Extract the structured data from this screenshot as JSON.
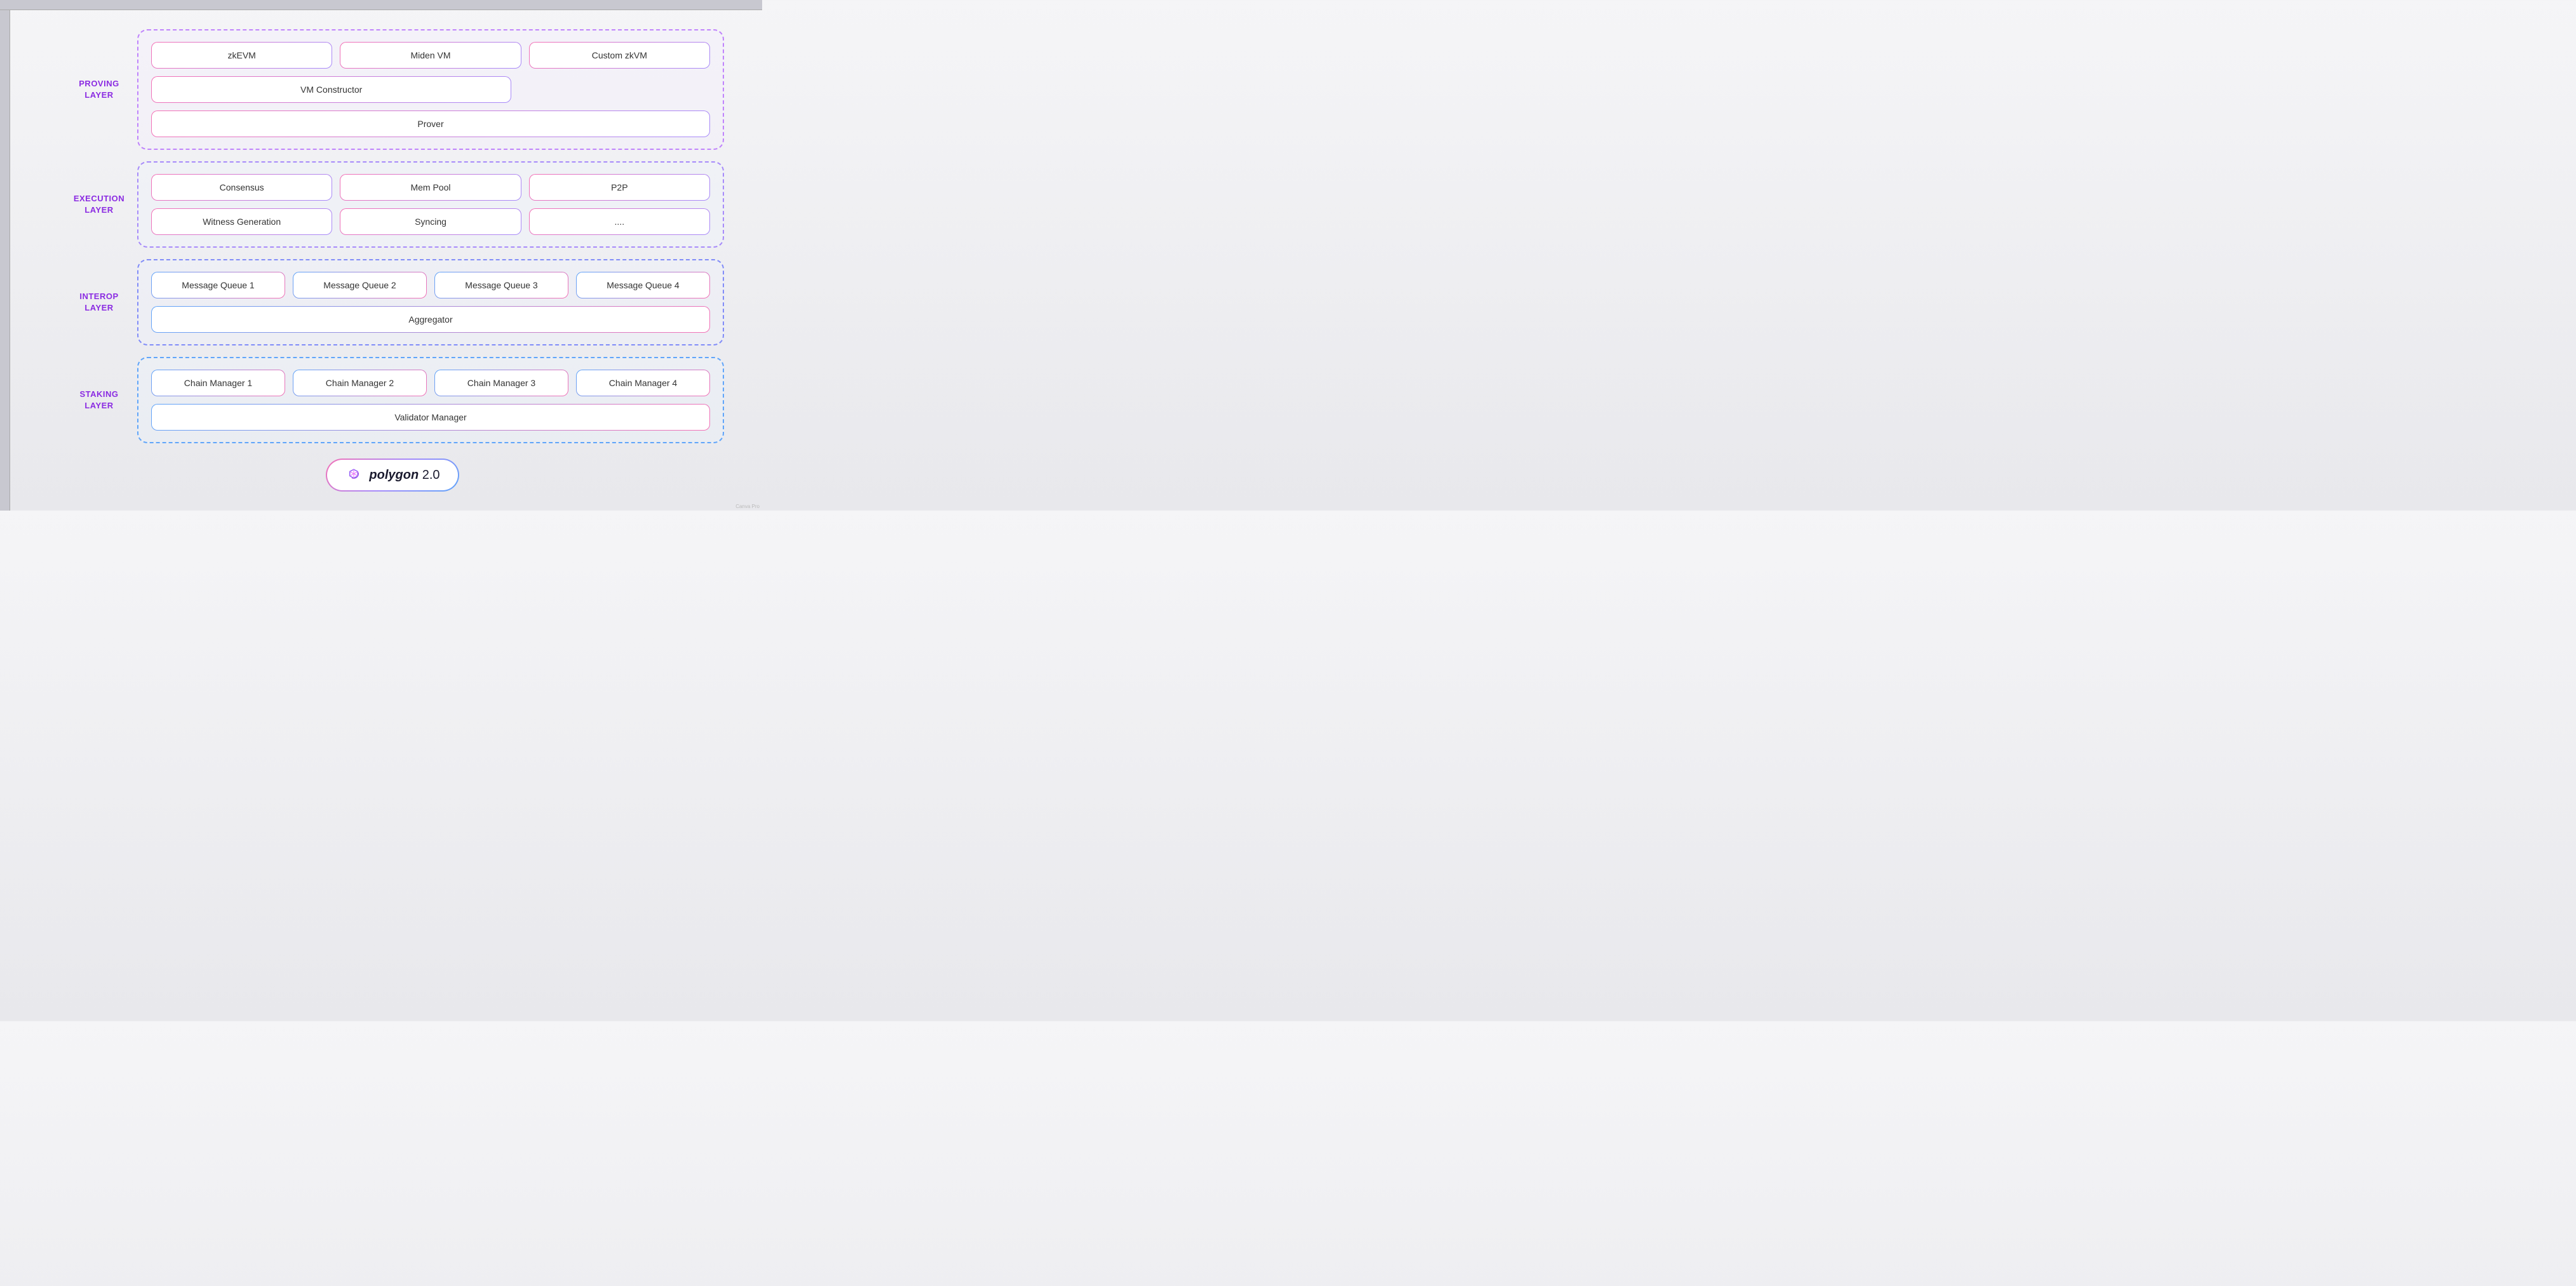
{
  "layers": [
    {
      "id": "proving",
      "label": "PROVING\nLAYER",
      "label_line1": "PROVING",
      "label_line2": "LAYER",
      "rows": [
        {
          "items": [
            {
              "text": "zkEVM",
              "flex": 1
            },
            {
              "text": "Miden VM",
              "flex": 1
            },
            {
              "text": "Custom zkVM",
              "flex": 1
            }
          ]
        },
        {
          "items": [
            {
              "text": "VM Constructor",
              "flex": 2
            },
            {
              "text": "",
              "flex": 0,
              "hidden": true
            }
          ],
          "full": false
        },
        {
          "items": [
            {
              "text": "Prover",
              "flex": 1
            }
          ],
          "full": true
        }
      ]
    },
    {
      "id": "execution",
      "label_line1": "EXECUTION",
      "label_line2": "LAYER",
      "rows": [
        {
          "items": [
            {
              "text": "Consensus",
              "flex": 1
            },
            {
              "text": "Mem Pool",
              "flex": 1
            },
            {
              "text": "P2P",
              "flex": 1
            }
          ]
        },
        {
          "items": [
            {
              "text": "Witness Generation",
              "flex": 1
            },
            {
              "text": "Syncing",
              "flex": 1
            },
            {
              "text": "....",
              "flex": 1
            }
          ]
        }
      ]
    },
    {
      "id": "interop",
      "label_line1": "INTEROP",
      "label_line2": "LAYER",
      "rows": [
        {
          "items": [
            {
              "text": "Message Queue 1",
              "flex": 1
            },
            {
              "text": "Message Queue 2",
              "flex": 1
            },
            {
              "text": "Message Queue 3",
              "flex": 1
            },
            {
              "text": "Message Queue 4",
              "flex": 1
            }
          ]
        },
        {
          "items": [
            {
              "text": "Aggregator",
              "flex": 1
            }
          ],
          "full": true
        }
      ]
    },
    {
      "id": "staking",
      "label_line1": "STAKING",
      "label_line2": "LAYER",
      "rows": [
        {
          "items": [
            {
              "text": "Chain Manager 1",
              "flex": 1
            },
            {
              "text": "Chain Manager 2",
              "flex": 1
            },
            {
              "text": "Chain Manager 3",
              "flex": 1
            },
            {
              "text": "Chain Manager 4",
              "flex": 1
            }
          ]
        },
        {
          "items": [
            {
              "text": "Validator Manager",
              "flex": 1
            }
          ],
          "full": true
        }
      ]
    }
  ],
  "polygon_badge": {
    "text_main": "polygon",
    "text_version": "2.0"
  },
  "ruler": {
    "show": true
  }
}
